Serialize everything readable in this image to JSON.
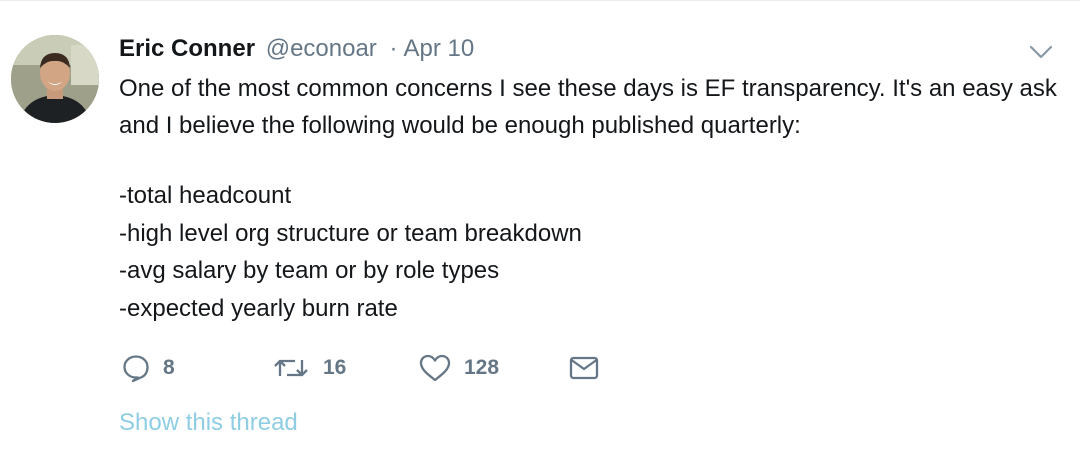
{
  "tweet": {
    "author_name": "Eric Conner",
    "handle": "@econoar",
    "separator": "·",
    "date": "Apr 10",
    "text_intro": "One of the most common concerns I see these days is EF transparency. It's an easy ask and I believe the following would be enough published quarterly:",
    "list_items": [
      "-total headcount",
      "-high level org structure or team breakdown",
      "-avg salary by team or by role types",
      "-expected yearly burn rate"
    ]
  },
  "actions": {
    "reply_count": "8",
    "retweet_count": "16",
    "like_count": "128"
  },
  "icons": {
    "reply": "reply-icon",
    "retweet": "retweet-icon",
    "like": "heart-icon",
    "message": "envelope-icon",
    "menu": "chevron-down-icon"
  },
  "show_thread_label": "Show this thread",
  "colors": {
    "text_primary": "#14171a",
    "text_secondary": "#657786",
    "link_light": "#8ecde3"
  }
}
